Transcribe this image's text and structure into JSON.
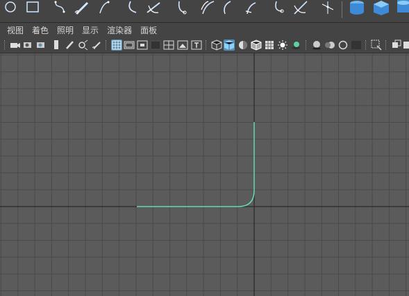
{
  "shelf": {
    "icons": [
      "nurbs-circle-icon",
      "nurbs-square-icon",
      "cv-curve-icon",
      "pencil-curve-icon",
      "ep-curve-icon",
      "arc-icon",
      "bezier-curve-icon",
      "attach-curve-icon",
      "detach-curve-icon",
      "extend-curve-icon",
      "offset-curve-icon",
      "fillet-curve-icon",
      "cut-curve-icon",
      "intersect-curve-icon",
      "rebuild-curve-icon",
      "nurbs-cylinder-icon",
      "nurbs-cube-icon",
      "nurbs-cone-icon"
    ]
  },
  "menu": {
    "items": [
      "视图",
      "着色",
      "照明",
      "显示",
      "渲染器",
      "面板"
    ]
  },
  "toolbar": {
    "active_shading": "smooth-shade-icon"
  },
  "colors": {
    "viewport_bg": "#5b5b5b",
    "grid_line": "#4a4a4a",
    "axis_line": "#2b2b2b",
    "curve": "#63e0b7",
    "accent": "#5a8fb0"
  }
}
